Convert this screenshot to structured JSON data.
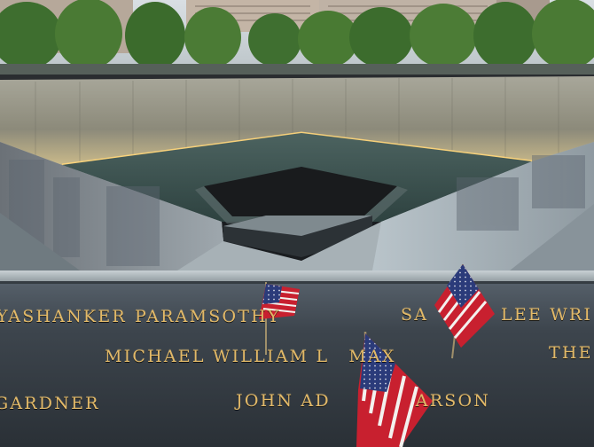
{
  "scene": {
    "subject": "National September 11 Memorial reflecting pool with engraved names and American flags",
    "engraved_names": {
      "row1_left": "YASHANKER",
      "row1_mid": "PARAMSOTHY",
      "row1_right_a": "SA",
      "row1_right_b": "LEE WRI",
      "row2_mid": "MICHAEL WILLIAM L",
      "row2_mid_b": "MAX",
      "row2_right": "THE",
      "row3_left": "GARDNER",
      "row3_mid": "JOHN AD",
      "row3_mid_b": "ARSON"
    },
    "colors": {
      "engraving": "#e2b968",
      "parapet": "#3f4750",
      "water": "#3e5552",
      "flag_red": "#c8202f",
      "flag_blue": "#2b3b7a"
    }
  }
}
